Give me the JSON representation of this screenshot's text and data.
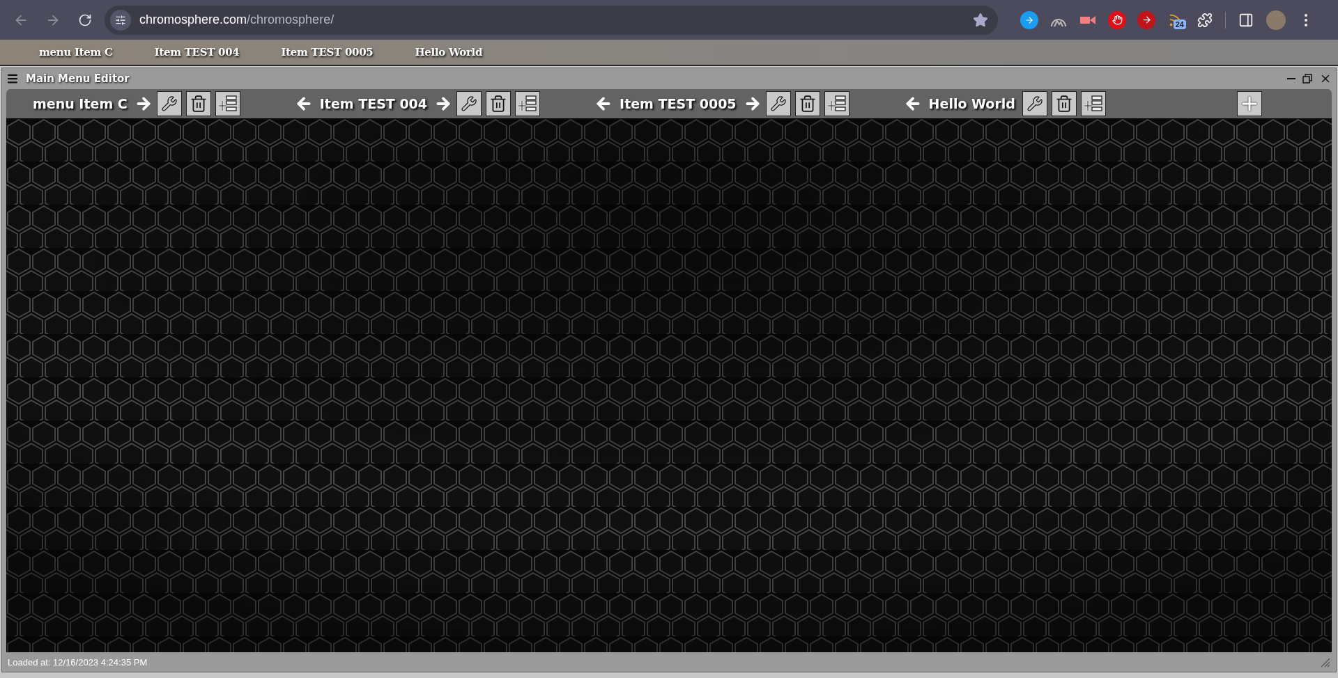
{
  "browser": {
    "url_host": "chromosphere.com",
    "url_path": "/chromosphere/",
    "extension_badge": "24"
  },
  "menu_bar": {
    "items": [
      "menu Item C",
      "Item TEST 004",
      "Item TEST 0005",
      "Hello World"
    ]
  },
  "editor": {
    "title": "Main Menu Editor",
    "items": [
      {
        "label": "menu Item C",
        "move_left": false,
        "move_right": true
      },
      {
        "label": "Item TEST 004",
        "move_left": true,
        "move_right": true
      },
      {
        "label": "Item TEST 0005",
        "move_left": true,
        "move_right": true
      },
      {
        "label": "Hello World",
        "move_left": true,
        "move_right": false
      }
    ],
    "status": "Loaded at: 12/16/2023 4:24:35 PM"
  }
}
